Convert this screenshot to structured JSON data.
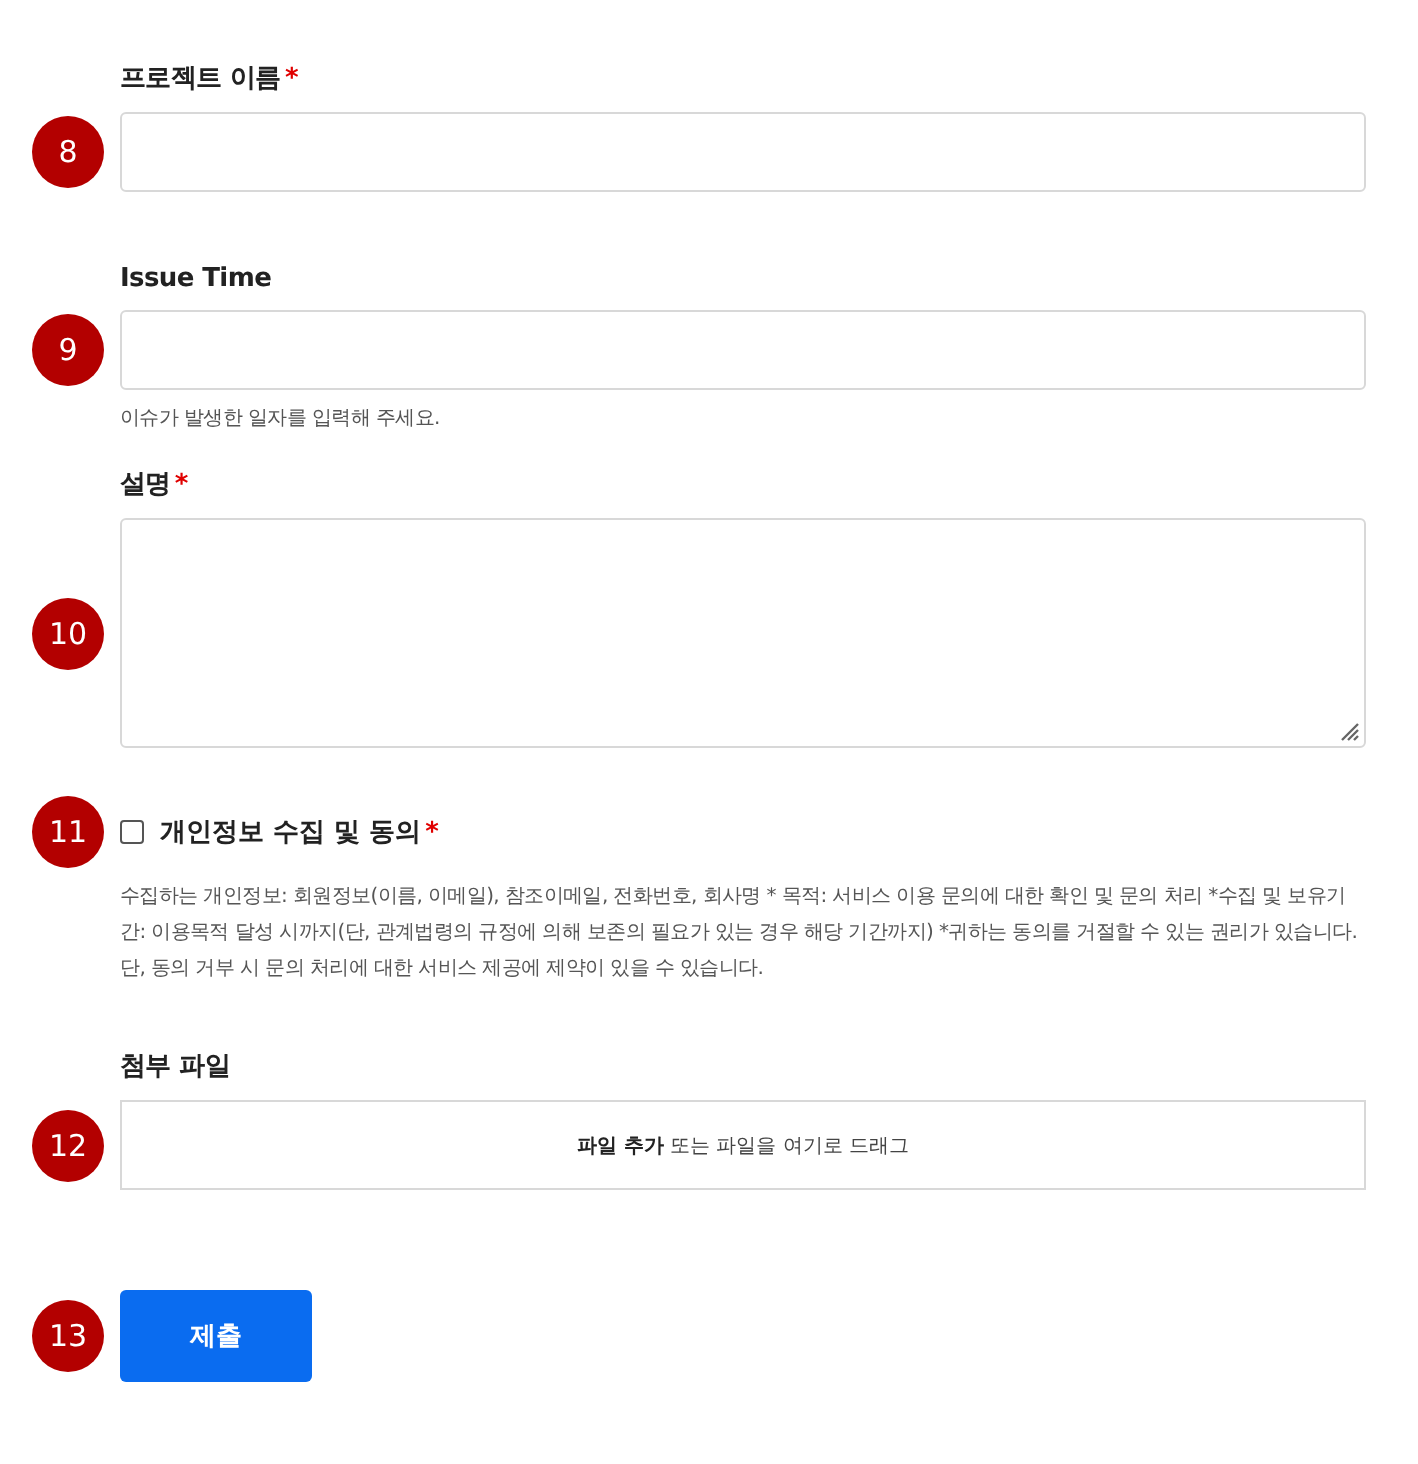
{
  "fields": [
    {
      "kind": "text",
      "number": "8",
      "label": "프로젝트 이름",
      "required_mark": "*"
    },
    {
      "kind": "text",
      "number": "9",
      "label": "Issue Time",
      "hint": "이슈가 발생한 일자를 입력해 주세요."
    },
    {
      "kind": "textarea",
      "number": "10",
      "label": "설명",
      "required_mark": "*"
    },
    {
      "kind": "checkbox",
      "number": "11",
      "label": "개인정보 수집 및 동의",
      "required_mark": "*",
      "checked": false,
      "hint": "수집하는 개인정보: 회원정보(이름, 이메일), 참조이메일, 전화번호, 회사명 * 목적: 서비스 이용 문의에 대한 확인 및 문의 처리 *수집 및 보유기간: 이용목적 달성 시까지(단, 관계법령의 규정에 의해 보존의 필요가 있는 경우 해당 기간까지) *귀하는 동의를 거절할 수 있는 권리가 있습니다. 단, 동의 거부 시 문의 처리에 대한 서비스 제공에 제약이 있을 수 있습니다."
    },
    {
      "kind": "file",
      "number": "12",
      "label": "첨부 파일",
      "dropzone": "**파일 추가** 또는 파일을 여기로 드래그"
    },
    {
      "kind": "submit",
      "number": "13",
      "button": "제출"
    }
  ]
}
